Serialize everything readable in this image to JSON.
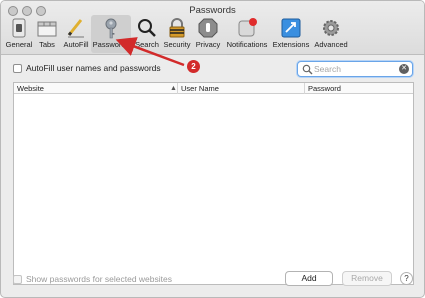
{
  "window": {
    "title": "Passwords"
  },
  "toolbar": {
    "items": [
      {
        "label": "General",
        "icon": "general-switch-icon"
      },
      {
        "label": "Tabs",
        "icon": "tabs-icon"
      },
      {
        "label": "AutoFill",
        "icon": "pencil-icon"
      },
      {
        "label": "Passwords",
        "icon": "key-icon",
        "selected": true
      },
      {
        "label": "Search",
        "icon": "magnifier-icon"
      },
      {
        "label": "Security",
        "icon": "lock-icon"
      },
      {
        "label": "Privacy",
        "icon": "hand-icon"
      },
      {
        "label": "Notifications",
        "icon": "notification-icon"
      },
      {
        "label": "Extensions",
        "icon": "puzzle-icon"
      },
      {
        "label": "Advanced",
        "icon": "gear-icon"
      }
    ]
  },
  "autofill": {
    "label": "AutoFill user names and passwords",
    "checked": false
  },
  "annotation": {
    "badge": "2",
    "color": "#d22a2a"
  },
  "search": {
    "placeholder": "Search",
    "value": ""
  },
  "table": {
    "columns": [
      "Website",
      "User Name",
      "Password"
    ],
    "rows": []
  },
  "footer": {
    "show_passwords_label": "Show passwords for selected websites",
    "add_label": "Add",
    "remove_label": "Remove",
    "help_label": "?"
  }
}
